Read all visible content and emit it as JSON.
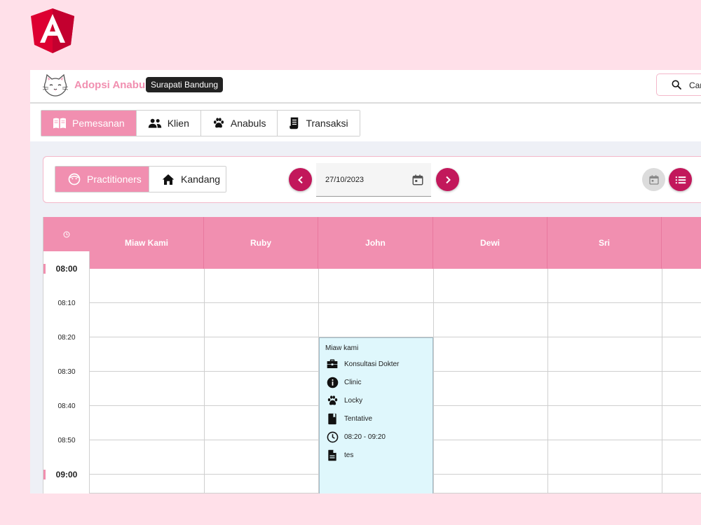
{
  "header": {
    "brand": "Adopsi Anabul",
    "branch": "Surapati Bandung",
    "search_text": "Car"
  },
  "nav": {
    "tabs": [
      {
        "label": "Pemesanan",
        "icon": "book-open-icon",
        "active": true
      },
      {
        "label": "Klien",
        "icon": "people-icon",
        "active": false
      },
      {
        "label": "Anabuls",
        "icon": "paw-icon",
        "active": false
      },
      {
        "label": "Transaksi",
        "icon": "receipt-icon",
        "active": false
      }
    ]
  },
  "toolbar": {
    "views": [
      {
        "label": "Practitioners",
        "icon": "face-icon",
        "active": true
      },
      {
        "label": "Kandang",
        "icon": "home-icon",
        "active": false
      }
    ],
    "date": "27/10/2023"
  },
  "calendar": {
    "columns": [
      "Miaw Kami",
      "Ruby",
      "John",
      "Dewi",
      "Sri",
      ""
    ],
    "times": [
      "08:00",
      "08:10",
      "08:20",
      "08:30",
      "08:40",
      "08:50",
      "09:00"
    ],
    "event": {
      "title": "Miaw kami",
      "column": "John",
      "start": "08:20",
      "end": "09:20",
      "rows": [
        {
          "icon": "briefcase-icon",
          "text": "Konsultasi Dokter"
        },
        {
          "icon": "info-icon",
          "text": "Clinic"
        },
        {
          "icon": "paw-icon",
          "text": "Locky"
        },
        {
          "icon": "book-icon",
          "text": "Tentative"
        },
        {
          "icon": "clock-icon",
          "text": "08:20 - 09:20"
        },
        {
          "icon": "document-icon",
          "text": "tes"
        }
      ]
    }
  },
  "colors": {
    "accent_pink": "#f18fb0",
    "button_magenta": "#c2185b",
    "angular_red": "#dd0031",
    "event_bg": "#dff7fc",
    "page_bg": "#ffe0e9"
  }
}
